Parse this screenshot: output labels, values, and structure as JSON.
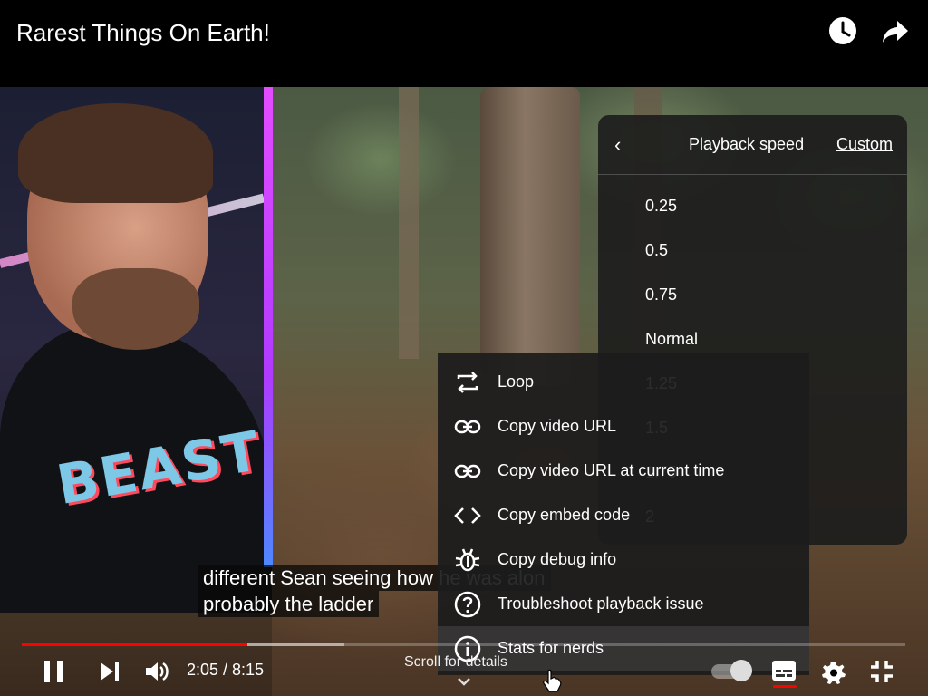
{
  "header": {
    "title": "Rarest Things On Earth!",
    "watch_later_icon": "clock-icon",
    "share_icon": "share-arrow-icon"
  },
  "captions": {
    "line1": "different Sean seeing how he was alon",
    "line2": "probably the ladder"
  },
  "overlay_text": {
    "shirt_logo": "BEAST"
  },
  "speed_menu": {
    "back_icon": "chevron-left-icon",
    "title": "Playback speed",
    "custom_label": "Custom",
    "options": [
      "0.25",
      "0.5",
      "0.75",
      "Normal",
      "1.25",
      "1.5",
      "1.75",
      "2"
    ]
  },
  "context_menu": {
    "items": [
      {
        "label": "Loop",
        "icon": "loop-icon"
      },
      {
        "label": "Copy video URL",
        "icon": "link-icon"
      },
      {
        "label": "Copy video URL at current time",
        "icon": "link-icon"
      },
      {
        "label": "Copy embed code",
        "icon": "code-icon"
      },
      {
        "label": "Copy debug info",
        "icon": "bug-icon"
      },
      {
        "label": "Troubleshoot playback issue",
        "icon": "question-icon"
      },
      {
        "label": "Stats for nerds",
        "icon": "info-icon"
      }
    ],
    "highlighted_index": 6
  },
  "controls": {
    "current_time": "2:05",
    "separator": " / ",
    "duration": "8:15",
    "time_text": "2:05 / 8:15",
    "played_fraction": 0.255,
    "buffered_fraction": 0.365,
    "scroll_hint": "Scroll for details",
    "buttons": [
      "pause-icon",
      "next-icon",
      "volume-icon",
      "autoplay-toggle",
      "cc-icon",
      "settings-gear-icon",
      "exit-fullscreen-icon"
    ],
    "accent_color": "#ff0000"
  }
}
